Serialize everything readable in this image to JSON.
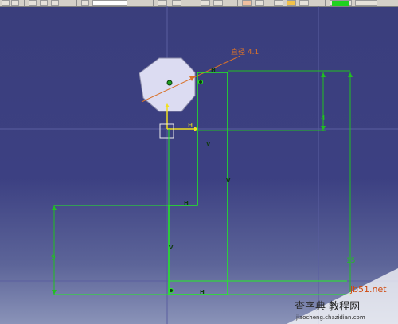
{
  "toolbar": {
    "icons": [
      "file-icon",
      "print-icon",
      "undo-icon",
      "select-dropdown",
      "curve-icon",
      "zoom-icon",
      "grid-icon",
      "snap-icon",
      "constraint-icon",
      "color-dropdown"
    ],
    "color_swatch": "#1fd11f"
  },
  "sketch": {
    "dimension_labels": {
      "diameter": "直径 4.1",
      "height_top": "4",
      "height_left": "9",
      "height_right": "15"
    },
    "constraint_markers": {
      "h": "H",
      "v": "V"
    },
    "axis_label_h": "H",
    "colors": {
      "profile": "#22ee22",
      "dimension": "#20c020",
      "annotation": "#d9722a",
      "axis": "#f0e020",
      "grid": "#5a5ea0",
      "polygon": "#dcdcf2"
    }
  },
  "watermark": {
    "site": "jb51.net",
    "text_cn": "查字典 教程网",
    "url": "jiaocheng.chazidian.com"
  }
}
